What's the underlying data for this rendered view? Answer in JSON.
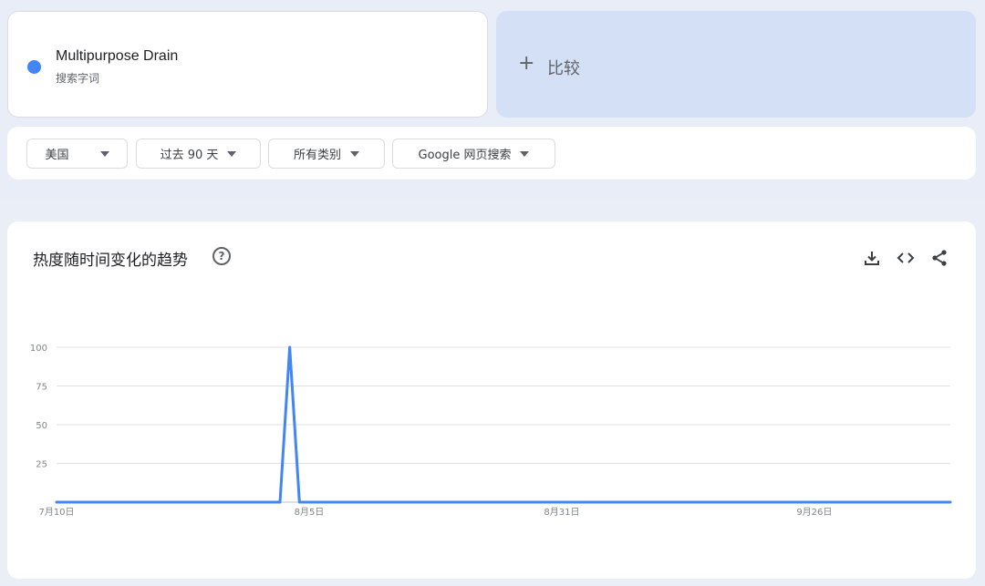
{
  "term": {
    "name": "Multipurpose Drain",
    "type_label": "搜索字词",
    "color": "#4285f4"
  },
  "compare": {
    "label": "比较"
  },
  "filters": [
    {
      "label": "美国"
    },
    {
      "label": "过去 90 天"
    },
    {
      "label": "所有类别"
    },
    {
      "label": "Google 网页搜索"
    }
  ],
  "chart_section": {
    "title": "热度随时间变化的趋势",
    "help_icon": "help-circle-icon",
    "tools": [
      "download-icon",
      "embed-code-icon",
      "share-icon"
    ]
  },
  "chart_data": {
    "type": "line",
    "title": "",
    "xlabel": "",
    "ylabel": "",
    "ylim": [
      0,
      100
    ],
    "y_ticks": [
      25,
      50,
      75,
      100
    ],
    "x_tick_labels": [
      {
        "label": "7月10日",
        "day": 0
      },
      {
        "label": "8月5日",
        "day": 26
      },
      {
        "label": "8月31日",
        "day": 52
      },
      {
        "label": "9月26日",
        "day": 78
      }
    ],
    "x_range_days": [
      0,
      92
    ],
    "grid": true,
    "series": [
      {
        "color": "#4285f4",
        "points": [
          {
            "day": 0,
            "value": 0
          },
          {
            "day": 23,
            "value": 0
          },
          {
            "day": 24,
            "value": 100
          },
          {
            "day": 25,
            "value": 0
          },
          {
            "day": 92,
            "value": 0
          }
        ]
      }
    ]
  }
}
